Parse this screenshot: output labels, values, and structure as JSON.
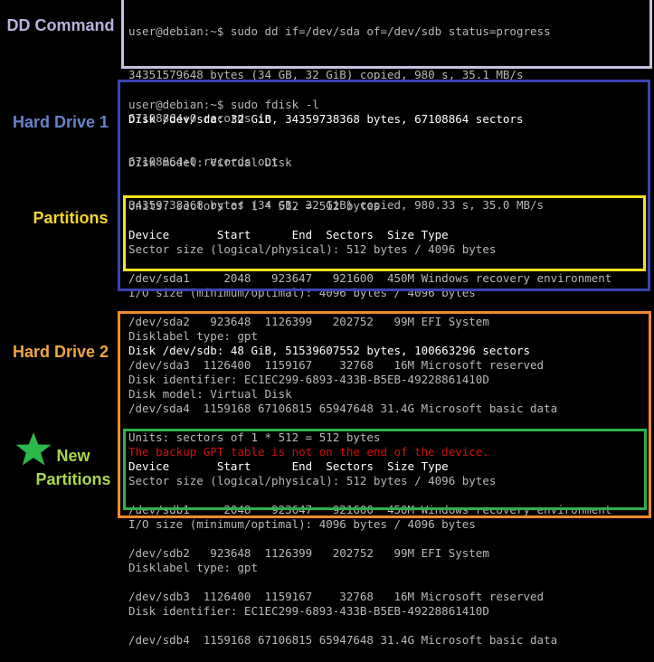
{
  "labels": {
    "dd_command": "DD Command",
    "hard_drive_1": "Hard Drive 1",
    "partitions": "Partitions",
    "hard_drive_2": "Hard Drive 2",
    "new_partitions_line1": "New",
    "new_partitions_line2": "Partitions"
  },
  "colors": {
    "dd_box": "#c9c0e0",
    "drive1_box": "#3a44b0",
    "partitions1_box": "#f5e21c",
    "drive2_box": "#f08a2c",
    "partitions2_box": "#2fb04a",
    "dd_label": "#b9b2dc",
    "drive1_label": "#6a82c8",
    "partitions_label": "#f5d629",
    "drive2_label": "#f0a640",
    "new_partitions_label": "#a8d84a",
    "star": "#2db84a",
    "error_text": "#d01010"
  },
  "icons": {
    "star": "star-icon"
  },
  "terminal": {
    "dd_lines": [
      "user@debian:~$ sudo dd if=/dev/sda of=/dev/sdb status=progress",
      "34351579648 bytes (34 GB, 32 GiB) copied, 980 s, 35.1 MB/s",
      "67108864+0 records in",
      "67108864+0 records out",
      "34359738368 bytes (34 GB, 32 GiB) copied, 980.33 s, 35.0 MB/s"
    ],
    "fdisk_prompt": "user@debian:~$ sudo fdisk -l",
    "drive1_lines": [
      "Disk /dev/sda: 32 GiB, 34359738368 bytes, 67108864 sectors",
      "Disk model: Virtual Disk",
      "Units: sectors of 1 * 512 = 512 bytes",
      "Sector size (logical/physical): 512 bytes / 4096 bytes",
      "I/O size (minimum/optimal): 4096 bytes / 4096 bytes",
      "Disklabel type: gpt",
      "Disk identifier: EC1EC299-6893-433B-B5EB-49228861410D"
    ],
    "partitions1_lines": [
      "Device       Start      End  Sectors  Size Type",
      "/dev/sda1     2048   923647   921600  450M Windows recovery environment",
      "/dev/sda2   923648  1126399   202752   99M EFI System",
      "/dev/sda3  1126400  1159167    32768   16M Microsoft reserved",
      "/dev/sda4  1159168 67106815 65947648 31.4G Microsoft basic data"
    ],
    "drive1_error": "The backup GPT table is not on the end of the device.",
    "drive2_lines": [
      "Disk /dev/sdb: 48 GiB, 51539607552 bytes, 100663296 sectors",
      "Disk model: Virtual Disk",
      "Units: sectors of 1 * 512 = 512 bytes",
      "Sector size (logical/physical): 512 bytes / 4096 bytes",
      "I/O size (minimum/optimal): 4096 bytes / 4096 bytes",
      "Disklabel type: gpt",
      "Disk identifier: EC1EC299-6893-433B-B5EB-49228861410D"
    ],
    "partitions2_lines": [
      "Device       Start      End  Sectors  Size Type",
      "/dev/sdb1     2048   923647   921600  450M Windows recovery environment",
      "/dev/sdb2   923648  1126399   202752   99M EFI System",
      "/dev/sdb3  1126400  1159167    32768   16M Microsoft reserved",
      "/dev/sdb4  1159168 67106815 65947648 31.4G Microsoft basic data"
    ]
  }
}
